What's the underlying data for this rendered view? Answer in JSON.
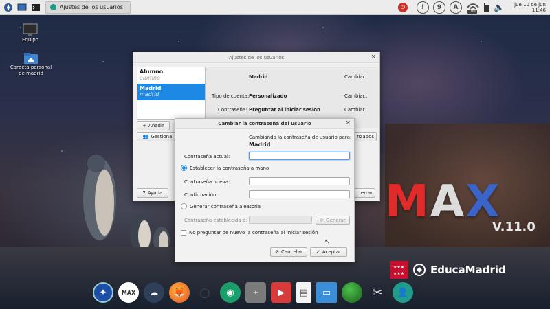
{
  "panel": {
    "task_title": "Ajustes de los usuarios",
    "tray": [
      "!",
      "9",
      "A"
    ],
    "clock_date": "jue 10 de jun",
    "clock_time": "11:46",
    "battery": "100"
  },
  "desktop": {
    "icons": [
      {
        "label": "Equipo"
      },
      {
        "label": "Carpeta personal\nde madrid"
      }
    ]
  },
  "user_settings": {
    "title": "Ajustes de los usuarios",
    "users": [
      {
        "name": "Alumno",
        "login": "alumno",
        "selected": false
      },
      {
        "name": "Madrid",
        "login": "madrid",
        "selected": true
      }
    ],
    "detail_name": "Madrid",
    "account_type_label": "Tipo de cuenta:",
    "account_type_value": "Personalizado",
    "password_label": "Contraseña:",
    "password_value": "Preguntar al iniciar sesión",
    "change_label": "Cambiar...",
    "add_label": "Añadir",
    "manage_label": "Gestiona",
    "advanced_suffix": "nzados",
    "help_label": "Ayuda",
    "close_suffix": "errar"
  },
  "password_dialog": {
    "title": "Cambiar la contraseña del usuario",
    "changing_for": "Cambiando la contraseña de usuario para:",
    "user": "Madrid",
    "current_label": "Contraseña actual:",
    "manual_option": "Establecer la contraseña a mano",
    "new_label": "Contraseña nueva:",
    "confirm_label": "Confirmación:",
    "random_option": "Generar contraseña aleatoria",
    "set_label": "Contraseña establecida a:",
    "generate_label": "Generar",
    "no_ask_label": "No preguntar de nuevo la contraseña al iniciar sesión",
    "cancel_label": "Cancelar",
    "accept_label": "Aceptar"
  },
  "branding": {
    "max_m": "M",
    "max_a": "A",
    "max_x": "X",
    "version": "V.11.0",
    "educa": "EducaMadrid"
  },
  "colors": {
    "selection": "#1e88e5",
    "max_red": "#e12a2a",
    "max_blue": "#3a64c8",
    "max_white": "#dcdcdc"
  }
}
